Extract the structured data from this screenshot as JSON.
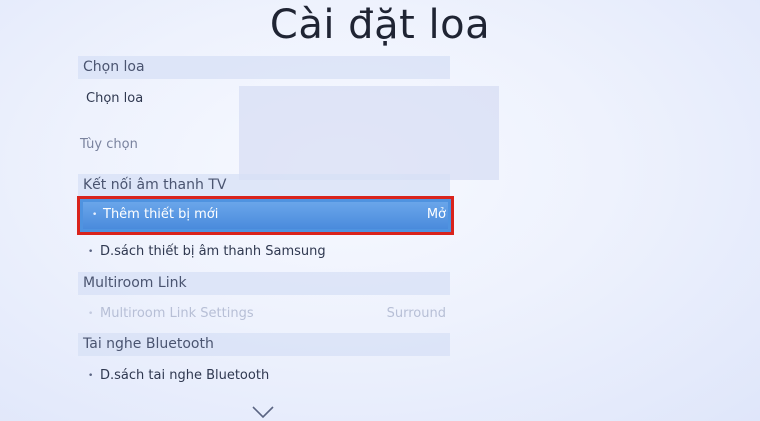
{
  "page": {
    "title": "Cài đặt loa"
  },
  "sections": {
    "chon_loa": {
      "header": "Chọn loa",
      "item": "Chọn loa"
    },
    "tuy_chon": {
      "label": "Tùy chọn"
    },
    "ket_noi": {
      "header": "Kết nối âm thanh TV",
      "selected_item": {
        "label": "Thêm thiết bị mới",
        "value": "Mở"
      },
      "item2": "D.sách thiết bị âm thanh Samsung"
    },
    "multiroom": {
      "header": "Multiroom Link",
      "item": {
        "label": "Multiroom Link Settings",
        "value": "Surround"
      }
    },
    "bluetooth": {
      "header": "Tai nghe Bluetooth",
      "item": "D.sách tai nghe Bluetooth"
    }
  },
  "icons": {
    "bullet": "•",
    "scroll_down": "chevron-down-icon"
  },
  "colors": {
    "highlight_border": "#d9231c",
    "highlight_fill": "#4f93e0"
  }
}
